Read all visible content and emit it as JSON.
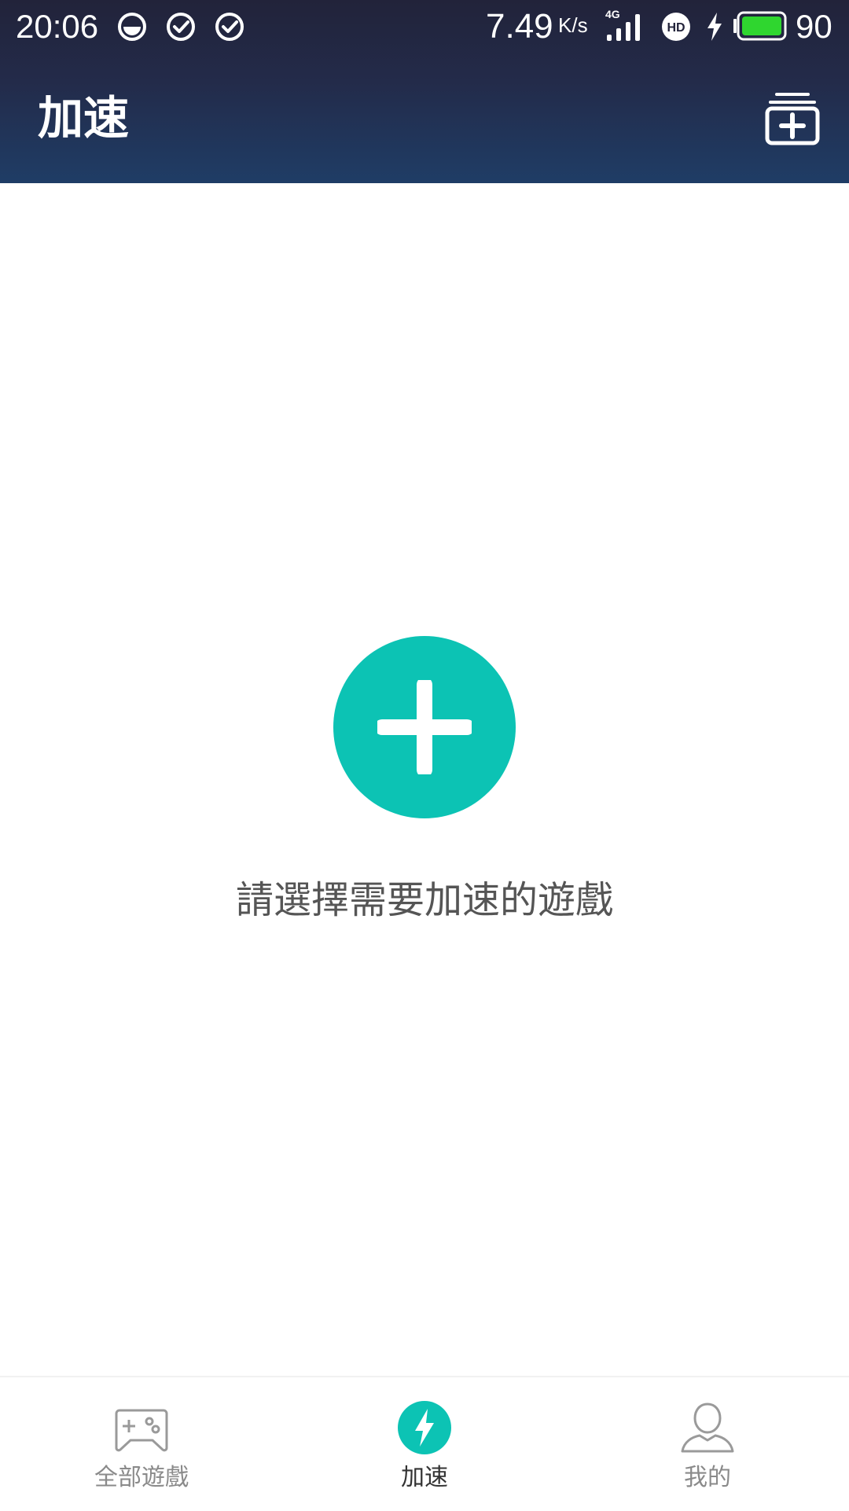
{
  "status_bar": {
    "time": "20:06",
    "left_icons": [
      "notification-icon",
      "check-circle-icon",
      "check-circle-icon"
    ],
    "network_speed": "7.49",
    "network_speed_unit": "K/s",
    "network_type": "4G",
    "hd_label": "HD",
    "battery_level": "90",
    "battery_color": "#2fd62f"
  },
  "header": {
    "title": "加速",
    "action_icon": "add-game-icon"
  },
  "empty_state": {
    "icon": "plus-icon",
    "message": "請選擇需要加速的遊戲",
    "accent_color": "#0cc3b4"
  },
  "bottom_nav": {
    "items": [
      {
        "label": "全部遊戲",
        "icon": "gamepad-icon",
        "active": false
      },
      {
        "label": "加速",
        "icon": "lightning-icon",
        "active": true
      },
      {
        "label": "我的",
        "icon": "user-icon",
        "active": false
      }
    ]
  }
}
